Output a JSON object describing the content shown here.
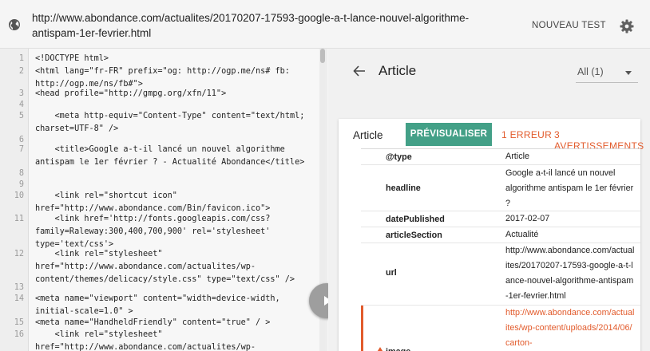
{
  "topbar": {
    "url": "http://www.abondance.com/actualites/20170207-17593-google-a-t-lance-nouvel-algorithme-antispam-1er-fevrier.html",
    "new_test_label": "NOUVEAU TEST",
    "globe_icon": "globe-icon",
    "settings_icon": "gear-icon"
  },
  "code": {
    "lines": [
      {
        "n": "1",
        "text": "<!DOCTYPE html>"
      },
      {
        "n": "2",
        "text": "<html lang=\"fr-FR\" prefix=\"og: http://ogp.me/ns# fb: http://ogp.me/ns/fb#\">"
      },
      {
        "n": "3",
        "text": "<head profile=\"http://gmpg.org/xfn/11\">"
      },
      {
        "n": "4",
        "text": ""
      },
      {
        "n": "5",
        "text": "    <meta http-equiv=\"Content-Type\" content=\"text/html; charset=UTF-8\" />"
      },
      {
        "n": "6",
        "text": ""
      },
      {
        "n": "7",
        "text": "    <title>Google a-t-il lancé un nouvel algorithme antispam le 1er février ? - Actualité Abondance</title>"
      },
      {
        "n": "8",
        "text": ""
      },
      {
        "n": "9",
        "text": ""
      },
      {
        "n": "10",
        "text": "    <link rel=\"shortcut icon\" href=\"http://www.abondance.com/Bin/favicon.ico\">"
      },
      {
        "n": "11",
        "text": "    <link href='http://fonts.googleapis.com/css?family=Raleway:300,400,700,900' rel='stylesheet' type='text/css'>"
      },
      {
        "n": "12",
        "text": "    <link rel=\"stylesheet\" href=\"http://www.abondance.com/actualites/wp-content/themes/delicacy/style.css\" type=\"text/css\" />"
      },
      {
        "n": "13",
        "text": ""
      },
      {
        "n": "14",
        "text": "<meta name=\"viewport\" content=\"width=device-width, initial-scale=1.0\" >"
      },
      {
        "n": "15",
        "text": "<meta name=\"HandheldFriendly\" content=\"true\" / >"
      },
      {
        "n": "16",
        "text": "    <link rel=\"stylesheet\" href=\"http://www.abondance.com/actualites/wp-"
      }
    ]
  },
  "play_icon": "play-icon",
  "right": {
    "back_icon": "arrow-left-icon",
    "title": "Article",
    "filter_value": "All (1)",
    "card": {
      "type_label": "Article",
      "preview_label": "PRÉVISUALISER",
      "errors_label": "1 ERREUR",
      "warnings_label": "3 AVERTISSEMENTS",
      "accent_color": "#43a087",
      "error_color": "#e25b2c",
      "rows": [
        {
          "key": "@type",
          "value": "Article"
        },
        {
          "key": "headline",
          "value": "Google a-t-il lancé un nouvel algorithme antispam le 1er février ?"
        },
        {
          "key": "datePublished",
          "value": "2017-02-07"
        },
        {
          "key": "articleSection",
          "value": "Actualité"
        },
        {
          "key": "url",
          "value": "http://www.abondance.com/actualites/20170207-17593-google-a-t-lance-nouvel-algorithme-antispam-1er-fevrier.html"
        },
        {
          "key": "image",
          "value": "http://www.abondance.com/actualites/wp-content/uploads/2014/06/carton-"
        }
      ]
    }
  }
}
